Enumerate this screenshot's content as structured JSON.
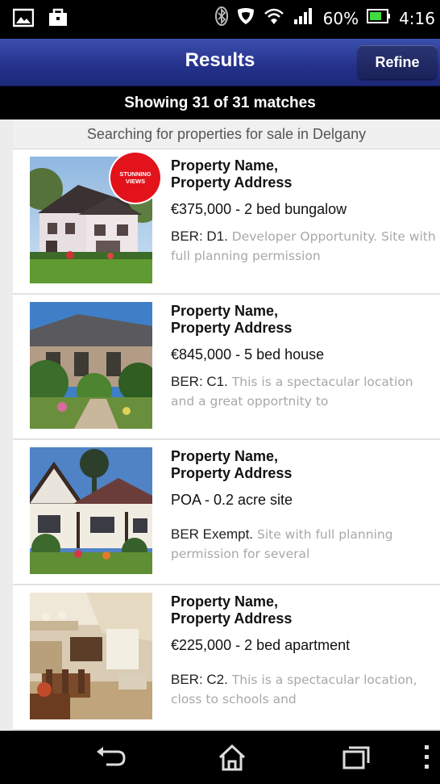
{
  "status_bar": {
    "battery_text": "60%",
    "time": "4:16"
  },
  "header": {
    "title": "Results",
    "refine_label": "Refine"
  },
  "matches_text": "Showing 31 of 31 matches",
  "search_context": "Searching for properties for sale in Delgany",
  "badge": {
    "line1": "STUNNING",
    "line2": "VIEWS"
  },
  "listings": [
    {
      "name": "Property Name,",
      "address": "Property Address",
      "price": "€375,000 - 2 bed bungalow",
      "ber": "BER: D1.",
      "desc": " Developer Opportunity. Site with full planning permission"
    },
    {
      "name": "Property Name,",
      "address": "Property Address",
      "price": "€845,000 - 5 bed house",
      "ber": "BER: C1.",
      "desc": " This is a spectacular location and a great opportnity to"
    },
    {
      "name": "Property Name,",
      "address": "Property Address",
      "price": "POA - 0.2 acre site",
      "ber": "BER Exempt.",
      "desc": " Site with full planning permission for several"
    },
    {
      "name": "Property Name,",
      "address": "Property Address",
      "price": "€225,000 - 2 bed apartment",
      "ber": "BER: C2.",
      "desc": " This is a spectacular location, closs to schools and"
    }
  ],
  "icons": {
    "status_left": [
      "image-icon",
      "briefcase-icon"
    ],
    "status_right": [
      "bluetooth-icon",
      "shield-icon",
      "wifi-icon",
      "signal-icon",
      "battery-icon"
    ],
    "nav": [
      "back-icon",
      "home-icon",
      "recent-apps-icon",
      "menu-dots-icon"
    ]
  },
  "colors": {
    "header": "#24318a",
    "badge": "#e3131b",
    "battery": "#3fdc3f"
  }
}
